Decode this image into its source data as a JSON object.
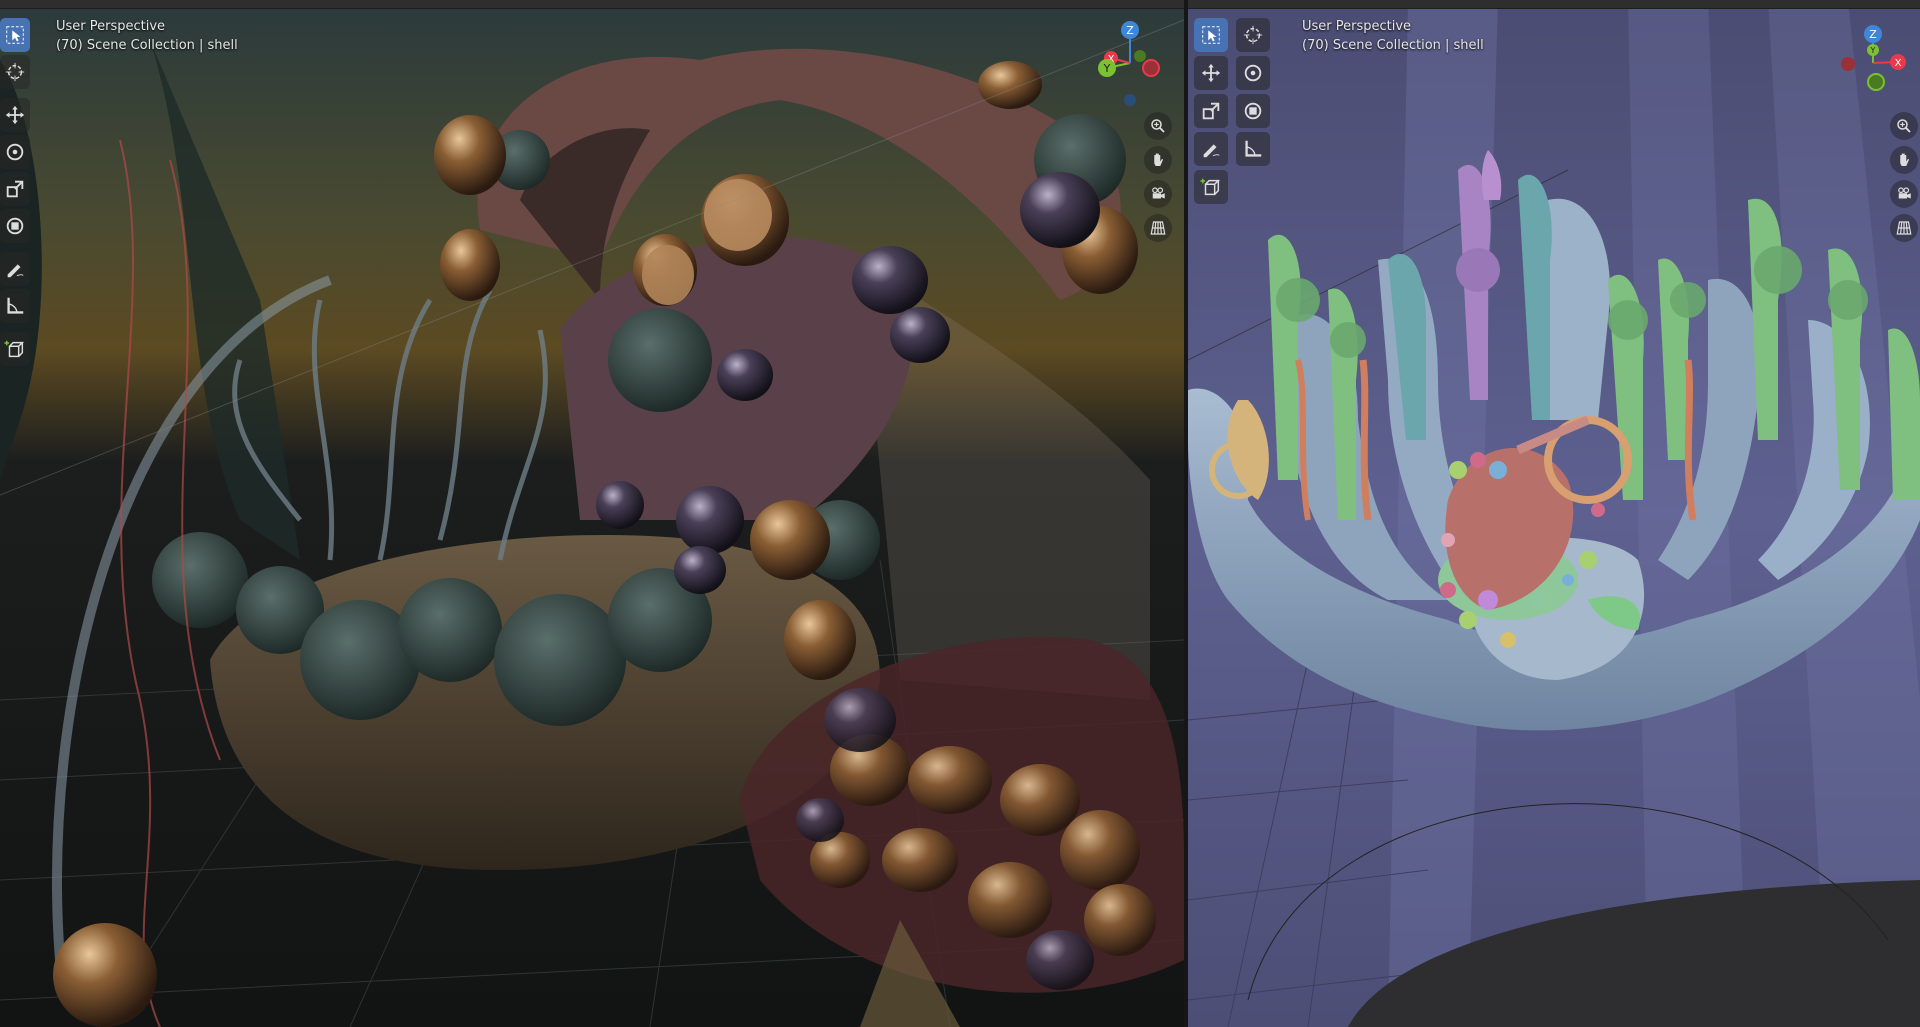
{
  "left_viewport": {
    "view_name": "User Perspective",
    "collection_info": "(70) Scene Collection | shell",
    "tools": [
      {
        "name": "select-box",
        "active": true
      },
      {
        "name": "cursor",
        "active": false
      },
      {
        "name": "move",
        "active": false
      },
      {
        "name": "rotate",
        "active": false
      },
      {
        "name": "scale",
        "active": false
      },
      {
        "name": "transform",
        "active": false
      },
      {
        "name": "annotate",
        "active": false
      },
      {
        "name": "measure",
        "active": false
      },
      {
        "name": "add-cube",
        "active": false
      }
    ],
    "navigation": [
      "zoom",
      "pan",
      "camera",
      "orthographic-grid"
    ],
    "gizmo_axes": [
      "Z",
      "X",
      "Y"
    ]
  },
  "right_viewport": {
    "view_name": "User Perspective",
    "collection_info": "(70) Scene Collection | shell",
    "tools": [
      {
        "name": "select-box",
        "active": true
      },
      {
        "name": "cursor",
        "active": false
      },
      {
        "name": "move",
        "active": false
      },
      {
        "name": "rotate",
        "active": false
      },
      {
        "name": "scale",
        "active": false
      },
      {
        "name": "transform",
        "active": false
      },
      {
        "name": "annotate",
        "active": false
      },
      {
        "name": "measure",
        "active": false
      },
      {
        "name": "add-cube",
        "active": false
      }
    ],
    "navigation": [
      "zoom",
      "pan",
      "camera",
      "orthographic-grid"
    ],
    "gizmo_axes": [
      "Z",
      "Y",
      "X"
    ]
  },
  "colors": {
    "active_tool": "#4772b3",
    "axis_x": "#e83a4b",
    "axis_y": "#7ac231",
    "axis_z": "#3e86d9",
    "right_bg": "#5c5f8c",
    "left_bg": "#1c2224"
  }
}
